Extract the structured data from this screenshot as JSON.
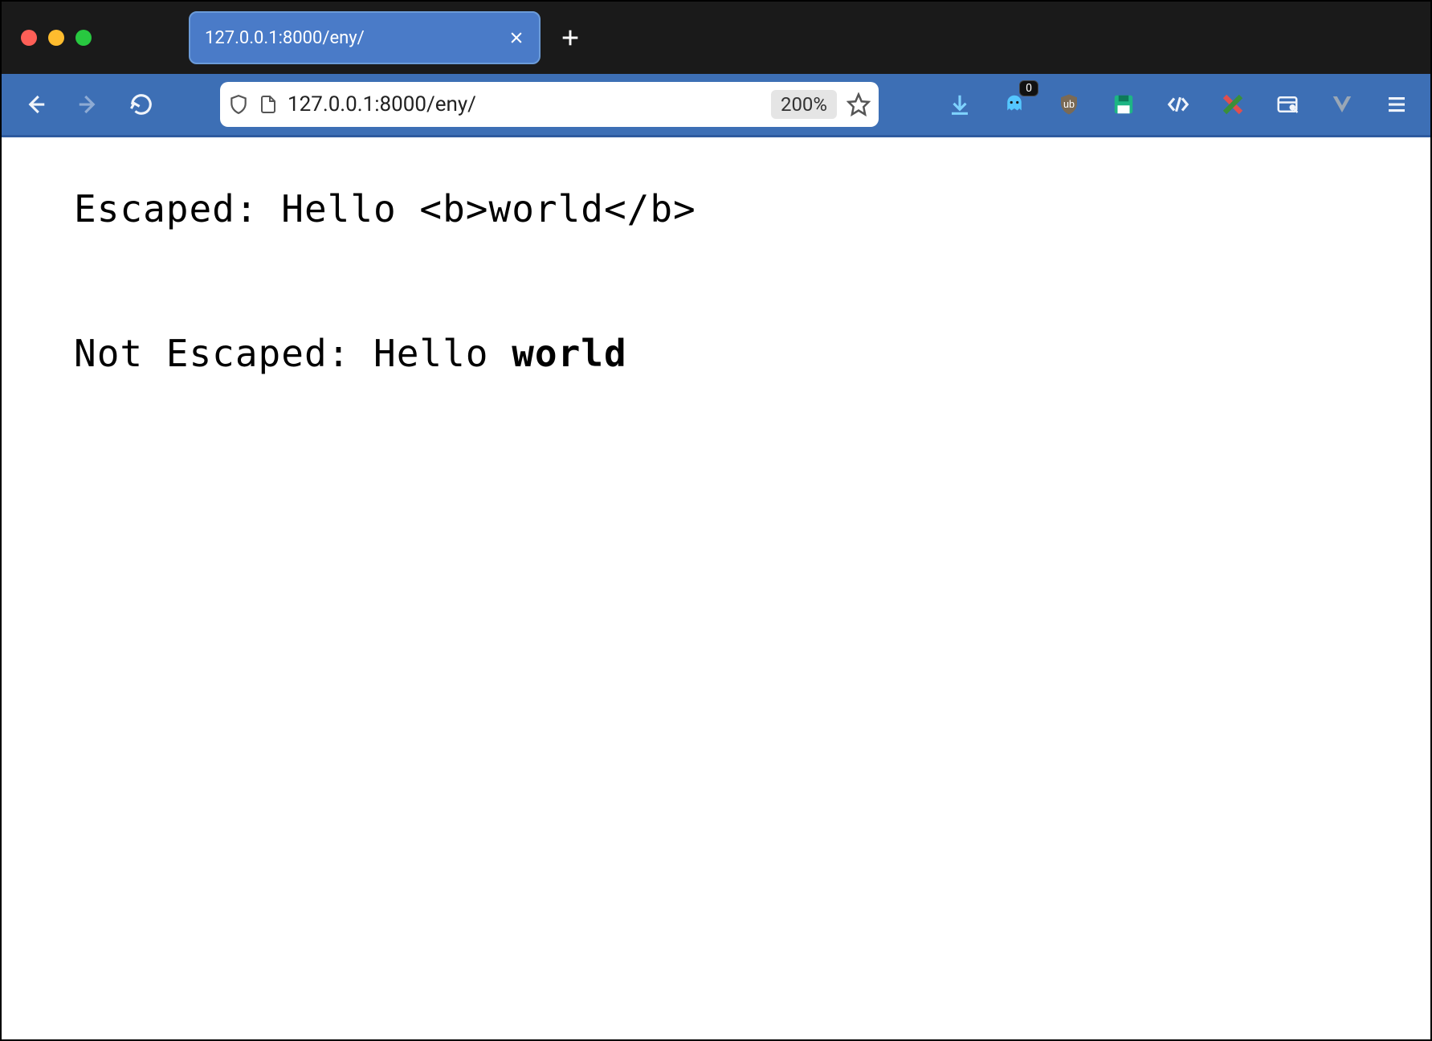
{
  "window": {
    "tab_title": "127.0.0.1:8000/eny/"
  },
  "toolbar": {
    "url": "127.0.0.1:8000/eny/",
    "zoom": "200%",
    "extension_badge": "0"
  },
  "content": {
    "line1_label": "Escaped: ",
    "line1_value": "Hello <b>world</b>",
    "line2_label": "Not Escaped: ",
    "line2_plain": "Hello ",
    "line2_bold": "world"
  }
}
